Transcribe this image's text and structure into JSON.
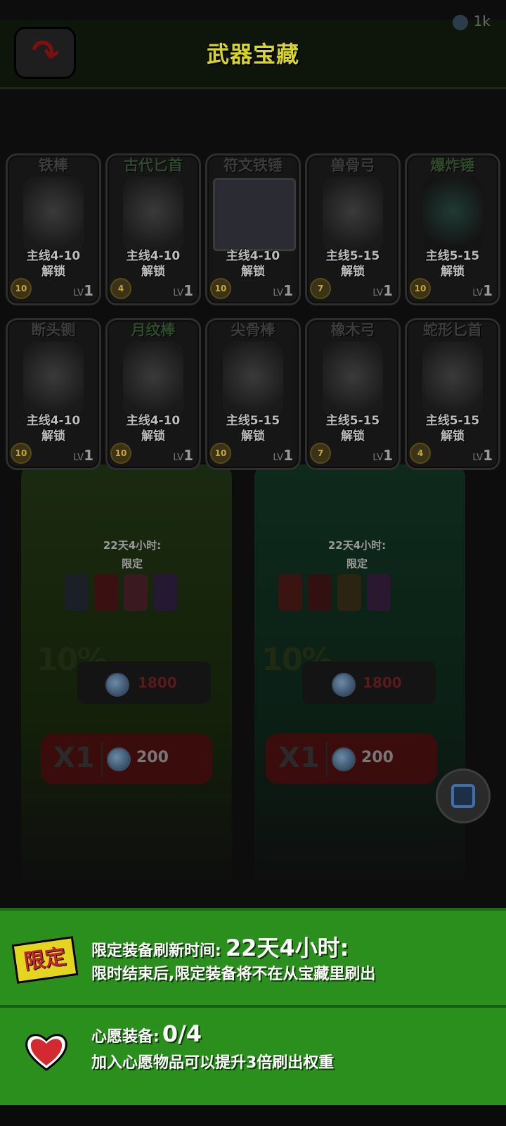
{
  "header": {
    "title": "武器宝藏",
    "currency_amount": "1k"
  },
  "weapons": [
    {
      "name": "铁棒",
      "unlock": "主线4-10",
      "unlock_label": "解锁",
      "badge": "10",
      "level": "1"
    },
    {
      "name": "古代匕首",
      "unlock": "主线4-10",
      "unlock_label": "解锁",
      "badge": "4",
      "level": "1"
    },
    {
      "name": "符文铁锤",
      "unlock": "主线4-10",
      "unlock_label": "解锁",
      "badge": "10",
      "level": "1"
    },
    {
      "name": "兽骨弓",
      "unlock": "主线5-15",
      "unlock_label": "解锁",
      "badge": "7",
      "level": "1"
    },
    {
      "name": "爆炸锤",
      "unlock": "主线5-15",
      "unlock_label": "解锁",
      "badge": "10",
      "level": "1"
    },
    {
      "name": "断头铡",
      "unlock": "主线4-10",
      "unlock_label": "解锁",
      "badge": "10",
      "level": "1"
    },
    {
      "name": "月纹棒",
      "unlock": "主线4-10",
      "unlock_label": "解锁",
      "badge": "10",
      "level": "1"
    },
    {
      "name": "尖骨棒",
      "unlock": "主线5-15",
      "unlock_label": "解锁",
      "badge": "10",
      "level": "1"
    },
    {
      "name": "橡木弓",
      "unlock": "主线5-15",
      "unlock_label": "解锁",
      "badge": "7",
      "level": "1"
    },
    {
      "name": "蛇形匕首",
      "unlock": "主线5-15",
      "unlock_label": "解锁",
      "badge": "4",
      "level": "1"
    }
  ],
  "level_prefix": "LV",
  "chests": [
    {
      "timer": "22天4小时:",
      "tag": "限定",
      "discount": "10%",
      "price_original": "1800",
      "buy_count": "X1",
      "buy_price": "200"
    },
    {
      "timer": "22天4小时:",
      "tag": "限定",
      "discount": "10%",
      "price_original": "1800",
      "buy_count": "X1",
      "buy_price": "200"
    }
  ],
  "limited_info": {
    "tag": "限定",
    "refresh_label": "限定装备刷新时间:",
    "refresh_time": "22天4小时:",
    "note": "限时结束后,限定装备将不在从宝藏里刷出"
  },
  "wish_info": {
    "label": "心愿装备:",
    "count": "0/4",
    "note": "加入心愿物品可以提升3倍刷出权重"
  },
  "colors": {
    "title": "#d9d428",
    "panel_green": "#2a8f1c",
    "tag_yellow": "#e3d520",
    "heart_red": "#d22a2f"
  }
}
